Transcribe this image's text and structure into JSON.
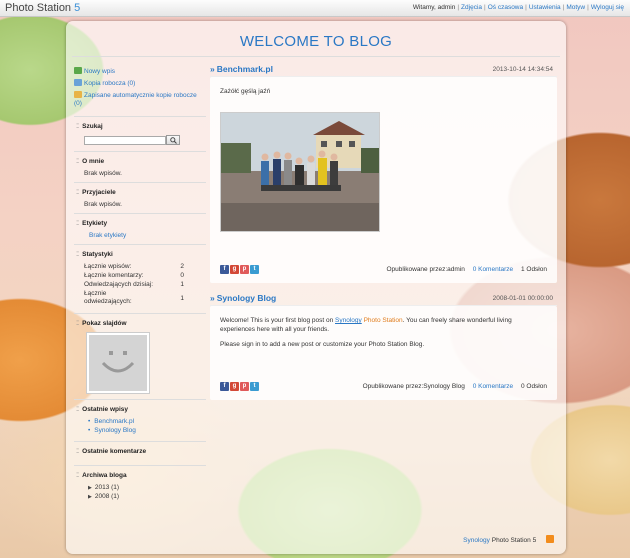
{
  "brand": {
    "name": "Photo Station",
    "version": "5"
  },
  "topnav": {
    "greeting": "Witamy, admin",
    "items": [
      "Zdjęcia",
      "Oś czasowa",
      "Ustawienia",
      "Motyw",
      "Wyloguj się"
    ]
  },
  "blog": {
    "title": "WELCOME TO BLOG"
  },
  "sidebar": {
    "actions": [
      "Nowy wpis",
      "Kopia robocza (0)",
      "Zapisane automatycznie kopie robocze (0)"
    ],
    "search": {
      "title": "Szukaj",
      "value": ""
    },
    "about": {
      "title": "O mnie",
      "text": "Brak wpisów."
    },
    "friends": {
      "title": "Przyjaciele",
      "text": "Brak wpisów."
    },
    "labels": {
      "title": "Etykiety",
      "text": "Brak etykiety"
    },
    "stats": {
      "title": "Statystyki",
      "rows": [
        {
          "label": "Łącznie wpisów:",
          "value": "2"
        },
        {
          "label": "Łącznie komentarzy:",
          "value": "0"
        },
        {
          "label": "Odwiedzających dzisiaj:",
          "value": "1"
        },
        {
          "label": "Łącznie odwiedzających:",
          "value": "1"
        }
      ]
    },
    "slideshow": {
      "title": "Pokaz slajdów"
    },
    "recent": {
      "title": "Ostatnie wpisy",
      "items": [
        "Benchmark.pl",
        "Synology Blog"
      ]
    },
    "comments": {
      "title": "Ostatnie komentarze"
    },
    "archive": {
      "title": "Archiwa bloga",
      "items": [
        "2013 (1)",
        "2008 (1)"
      ]
    }
  },
  "posts": [
    {
      "title": "Benchmark.pl",
      "date": "2013-10-14 14:34:54",
      "text": "Zażółć gęślą jaźń",
      "published_label": "Opublikowane przez:admin",
      "comments": "0 Komentarze",
      "views": "1 Odsłon"
    },
    {
      "title": "Synology Blog",
      "date": "2008-01-01 00:00:00",
      "text_prefix": "Welcome! This is your first blog post on ",
      "text_link": "Synology",
      "text_brand": " Photo Station",
      "text_suffix": ". You can freely share wonderful living experiences here with all your friends.",
      "text2": "Please sign in to add a new post or customize your Photo Station Blog.",
      "published_label": "Opublikowane przez:Synology Blog",
      "comments": "0 Komentarze",
      "views": "0 Odsłon"
    }
  ],
  "footer": {
    "link": "Synology",
    "text": "Photo Station 5"
  },
  "colors": {
    "accent": "#2a78c5",
    "brand_version": "#3a8fd6"
  }
}
